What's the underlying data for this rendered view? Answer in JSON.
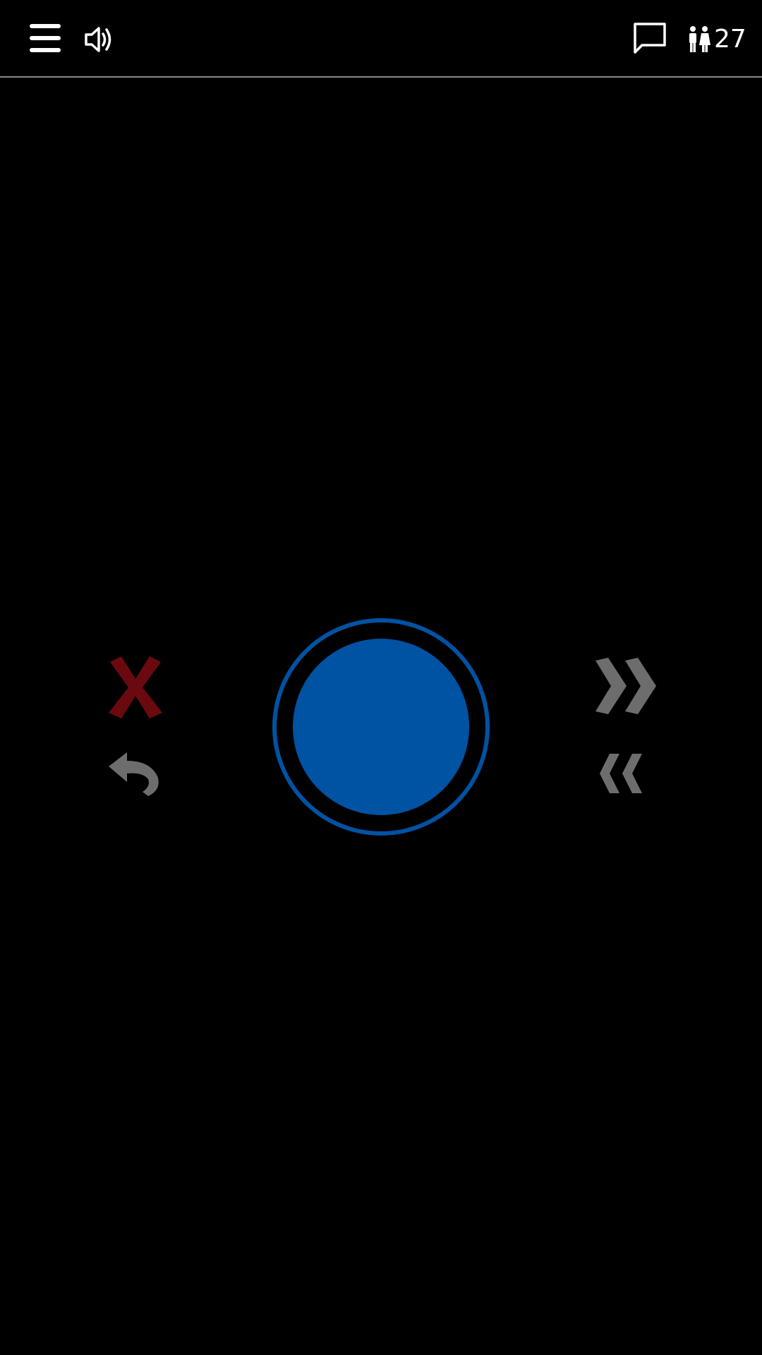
{
  "header": {
    "menu_icon": "hamburger-menu-icon",
    "sound_icon": "speaker-volume-icon",
    "chat_icon": "chat-bubble-icon",
    "users_icon": "people-icon",
    "users_count": "27"
  },
  "controls": {
    "main_button_icon": "blue-circle",
    "close_icon": "red-x-icon",
    "undo_icon": "undo-arrow-icon",
    "forward_icon": "double-chevron-right-icon",
    "back_icon": "double-chevron-left-icon"
  },
  "colors": {
    "background": "#000000",
    "accent_blue": "#0052a3",
    "close_red": "#6b0a0e",
    "icon_gray": "#6d6d6d",
    "divider": "#8a8a8a"
  }
}
